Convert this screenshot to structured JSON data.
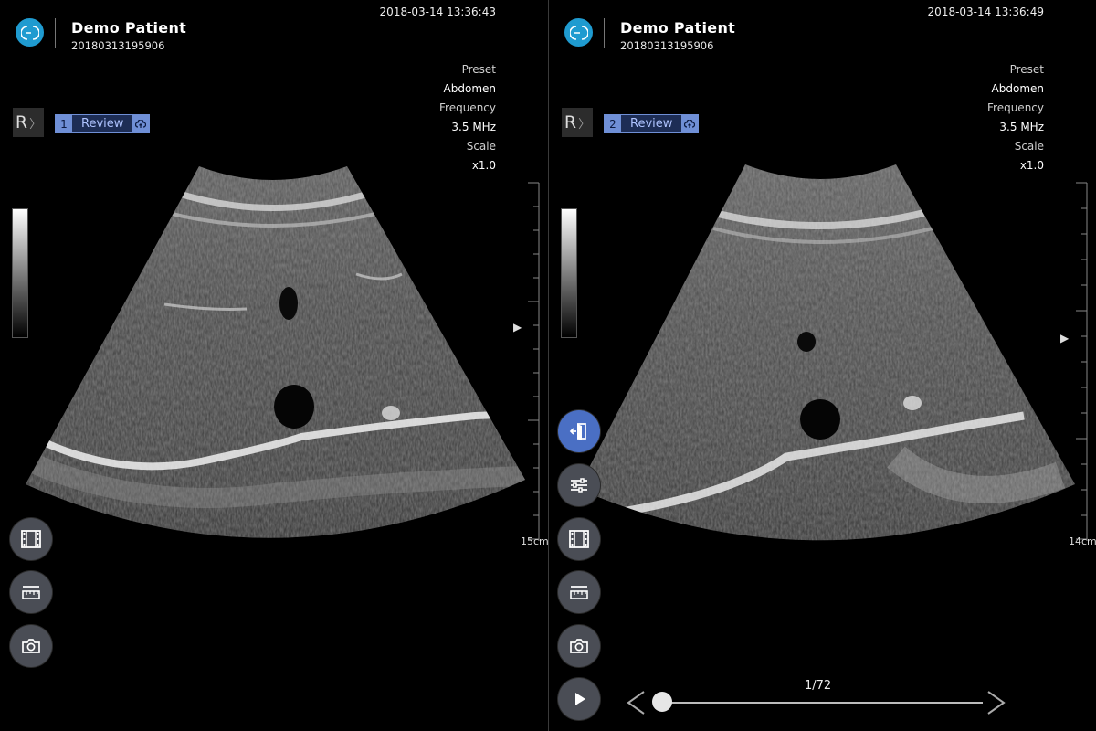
{
  "panels": [
    {
      "patient_name": "Demo Patient",
      "patient_id": "20180313195906",
      "datetime": "2018-03-14 13:36:43",
      "preset_label": "Preset",
      "preset_value": "Abdomen",
      "frequency_label": "Frequency",
      "frequency_value": "3.5 MHz",
      "scale_label": "Scale",
      "scale_value": "x1.0",
      "orientation": "R",
      "review_index": "1",
      "review_label": "Review",
      "depth": "15cm"
    },
    {
      "patient_name": "Demo Patient",
      "patient_id": "20180313195906",
      "datetime": "2018-03-14 13:36:49",
      "preset_label": "Preset",
      "preset_value": "Abdomen",
      "frequency_label": "Frequency",
      "frequency_value": "3.5 MHz",
      "scale_label": "Scale",
      "scale_value": "x1.0",
      "orientation": "R",
      "review_index": "2",
      "review_label": "Review",
      "depth": "14cm"
    }
  ],
  "playback": {
    "counter": "1/72",
    "progress": 0
  },
  "colors": {
    "logo": "#1f9bd0",
    "review_accent": "#6f8fd6",
    "active_button": "#4a6fc4",
    "control_button": "#4a4d55"
  }
}
